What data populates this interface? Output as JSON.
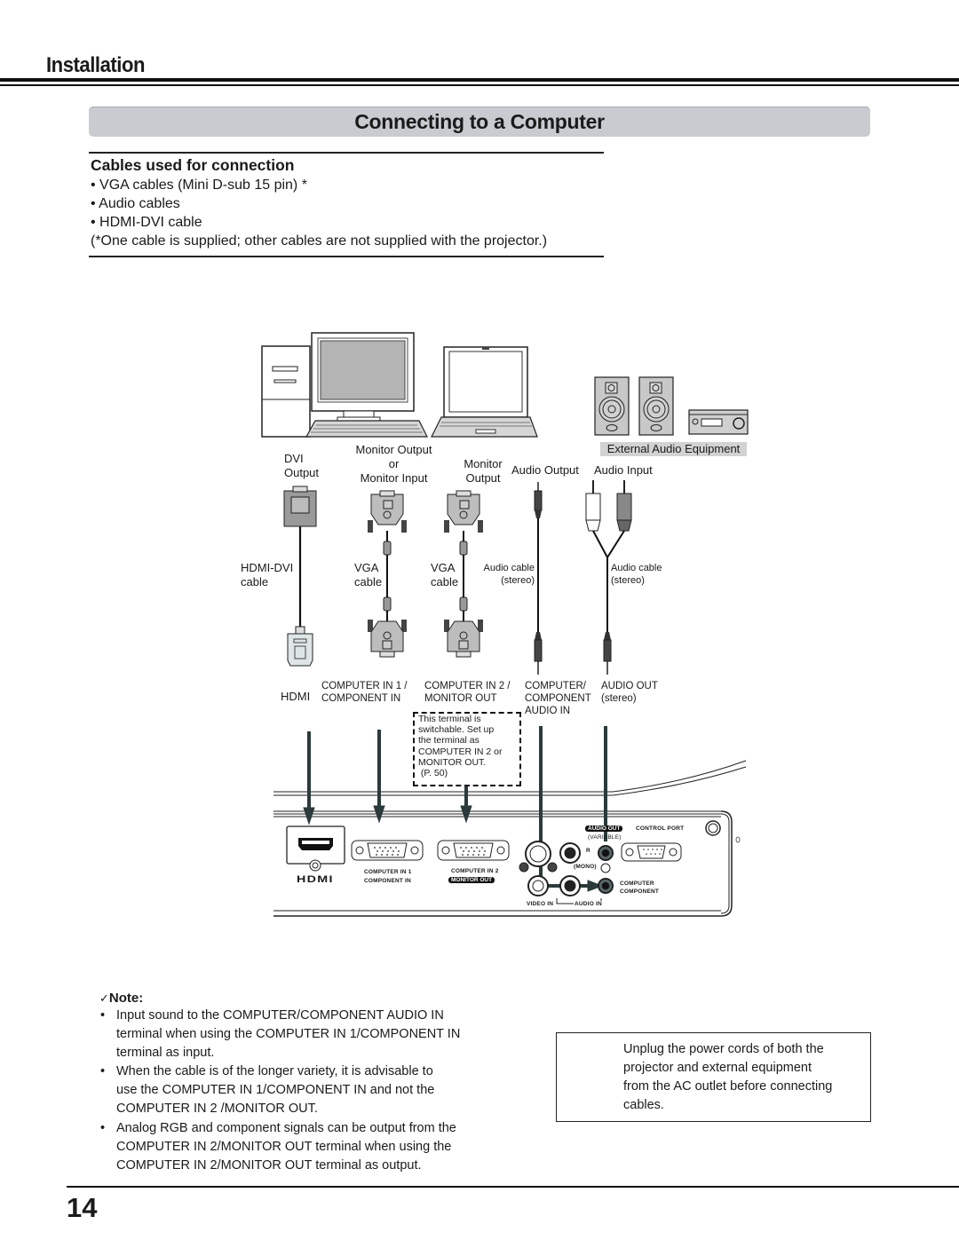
{
  "header": {
    "section_title": "Installation",
    "page_title": "Connecting to a Computer"
  },
  "cables_box": {
    "title": "Cables used for connection",
    "items": [
      "• VGA cables (Mini D-sub 15 pin) *",
      "• Audio cables",
      "• HDMI-DVI cable"
    ],
    "footnote": "(*One cable is supplied; other cables are not supplied with the projector.)"
  },
  "diagram": {
    "external_audio_label": "External Audio Equipment",
    "source_labels": {
      "dvi_output": [
        "DVI",
        "Output"
      ],
      "monitor_output_or_input": [
        "Monitor Output",
        "or",
        "Monitor Input"
      ],
      "monitor_output": [
        "Monitor",
        "Output"
      ],
      "audio_output": "Audio Output",
      "audio_input": "Audio Input"
    },
    "cable_labels": {
      "hdmi_dvi": [
        "HDMI-DVI",
        "cable"
      ],
      "vga_1": [
        "VGA",
        "cable"
      ],
      "vga_2": [
        "VGA",
        "cable"
      ],
      "audio_1": [
        "Audio cable",
        "(stereo)"
      ],
      "audio_2": [
        "Audio cable",
        "(stereo)"
      ]
    },
    "terminal_labels": {
      "hdmi": "HDMI",
      "computer_in_1": [
        "COMPUTER IN 1 /",
        "COMPONENT IN"
      ],
      "computer_in_2": [
        "COMPUTER IN 2 /",
        "MONITOR OUT"
      ],
      "audio_in": [
        "COMPUTER/",
        "COMPONENT",
        "AUDIO IN"
      ],
      "audio_out": [
        "AUDIO OUT",
        "(stereo)"
      ]
    },
    "switchable_note": [
      "This terminal is",
      "switchable. Set up",
      "the terminal as",
      "COMPUTER IN 2 or",
      "MONITOR OUT.",
      " (P. 50)"
    ],
    "panel_labels": {
      "hdmi_logo": "HDMI",
      "computer_in_1": [
        "COMPUTER IN 1",
        "COMPONENT IN"
      ],
      "computer_in_2": "COMPUTER IN 2",
      "monitor_out": "MONITOR OUT",
      "audio_out": "AUDIO OUT",
      "variable": "(VARIABLE)",
      "control_port": "CONTROL PORT",
      "r": "R",
      "mono": "(MONO)",
      "computer_component": [
        "COMPUTER",
        "COMPONENT"
      ],
      "video_in": "VIDEO IN",
      "audio_in": "AUDIO IN"
    }
  },
  "note": {
    "title": "Note:",
    "check_icon": "✓",
    "items": [
      [
        "Input sound to the COMPUTER/COMPONENT AUDIO IN",
        "terminal when using the COMPUTER IN 1/COMPONENT IN",
        "terminal as input."
      ],
      [
        "When the cable is of the longer variety, it is advisable to",
        "use the COMPUTER IN 1/COMPONENT IN and not the",
        "COMPUTER IN 2 /MONITOR OUT."
      ],
      [
        "Analog RGB and component signals can be output from the",
        "COMPUTER IN 2/MONITOR OUT terminal when using the",
        "COMPUTER IN 2/MONITOR OUT terminal as output."
      ]
    ]
  },
  "warning": {
    "icon": "warning-triangle",
    "lines": [
      "Unplug the power cords of both the",
      "projector and external equipment",
      "from the AC outlet before connecting",
      "cables."
    ]
  },
  "footer": {
    "page_number": "14"
  }
}
